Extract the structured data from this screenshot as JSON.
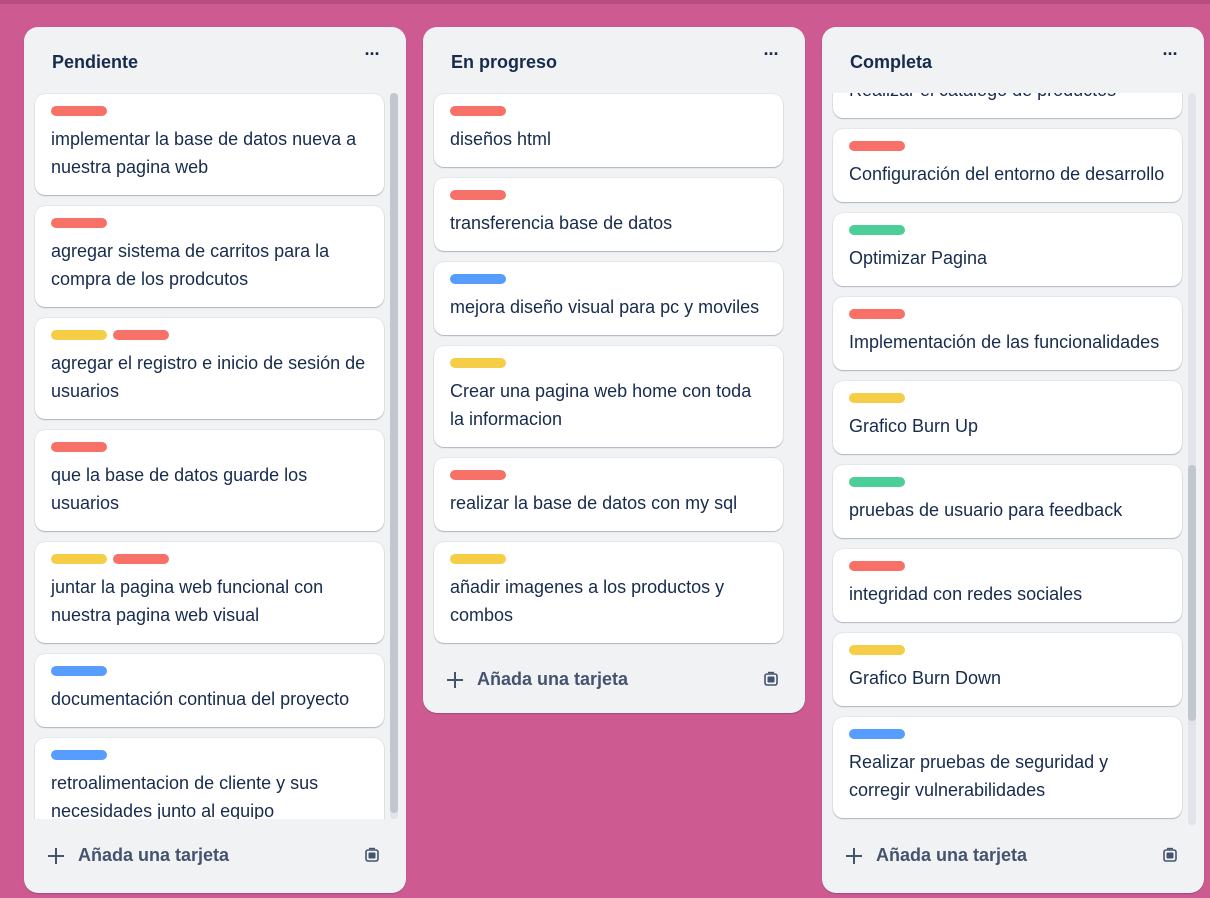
{
  "colors": {
    "red": "#f87168",
    "yellow": "#f5cd47",
    "green": "#4bce97",
    "blue": "#579dff",
    "board_background": "#cd5a91"
  },
  "lists": [
    {
      "title": "Pendiente",
      "more_icon": "more-horizontal-icon",
      "add_label": "Añada una tarjeta",
      "cards": [
        {
          "labels": [
            "red"
          ],
          "title": "implementar la base de datos nueva a nuestra pagina web"
        },
        {
          "labels": [
            "red"
          ],
          "title": "agregar sistema de carritos para la compra de los prodcutos"
        },
        {
          "labels": [
            "yellow",
            "red"
          ],
          "title": "agregar el registro e inicio de sesión de usuarios"
        },
        {
          "labels": [
            "red"
          ],
          "title": "que la base de datos guarde los usuarios"
        },
        {
          "labels": [
            "yellow",
            "red"
          ],
          "title": "juntar la pagina web funcional con nuestra pagina web visual"
        },
        {
          "labels": [
            "blue"
          ],
          "title": "documentación continua del proyecto"
        },
        {
          "labels": [
            "blue"
          ],
          "title": "retroalimentacion de cliente y sus necesidades junto al equipo"
        }
      ]
    },
    {
      "title": "En progreso",
      "more_icon": "more-horizontal-icon",
      "add_label": "Añada una tarjeta",
      "cards": [
        {
          "labels": [
            "red"
          ],
          "title": "diseños html"
        },
        {
          "labels": [
            "red"
          ],
          "title": "transferencia base de datos"
        },
        {
          "labels": [
            "blue"
          ],
          "title": "mejora diseño visual para pc y moviles"
        },
        {
          "labels": [
            "yellow"
          ],
          "title": "Crear una pagina web home con toda la informacion"
        },
        {
          "labels": [
            "red"
          ],
          "title": "realizar la base de datos con my sql"
        },
        {
          "labels": [
            "yellow"
          ],
          "title": "añadir imagenes a los productos y combos"
        }
      ]
    },
    {
      "title": "Completa",
      "more_icon": "more-horizontal-icon",
      "add_label": "Añada una tarjeta",
      "cards": [
        {
          "labels": [],
          "title": "Realizar el catalogo de productos"
        },
        {
          "labels": [
            "red"
          ],
          "title": "Configuración del entorno de desarrollo"
        },
        {
          "labels": [
            "green"
          ],
          "title": "Optimizar Pagina"
        },
        {
          "labels": [
            "red"
          ],
          "title": "Implementación de las funcionalidades"
        },
        {
          "labels": [
            "yellow"
          ],
          "title": "Grafico Burn Up"
        },
        {
          "labels": [
            "green"
          ],
          "title": "pruebas de usuario para feedback"
        },
        {
          "labels": [
            "red"
          ],
          "title": "integridad con redes sociales"
        },
        {
          "labels": [
            "yellow"
          ],
          "title": "Grafico Burn Down"
        },
        {
          "labels": [
            "blue"
          ],
          "title": "Realizar pruebas de seguridad y corregir vulnerabilidades"
        }
      ]
    }
  ]
}
